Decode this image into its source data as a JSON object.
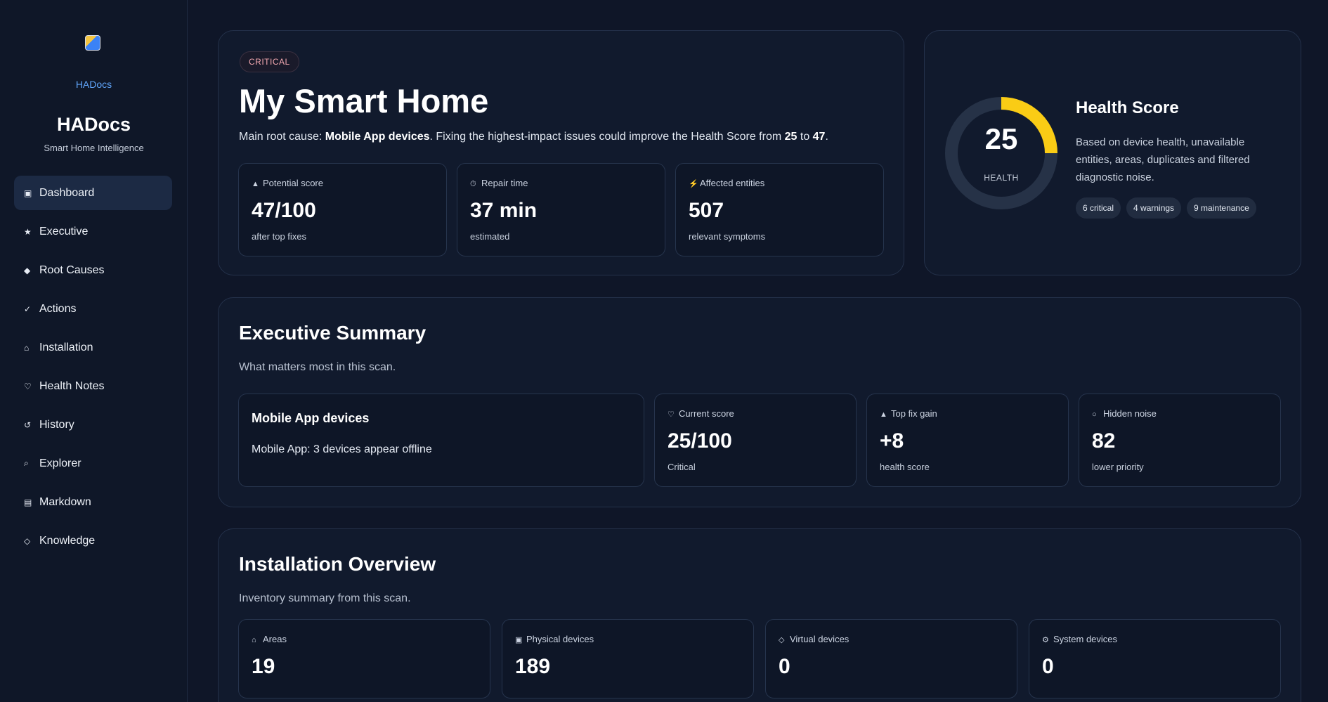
{
  "sidebar": {
    "logo_caption": "HADocs",
    "brand": "HADocs",
    "tagline": "Smart Home Intelligence",
    "items": [
      {
        "label": "Dashboard",
        "icon": "▣"
      },
      {
        "label": "Executive",
        "icon": "★"
      },
      {
        "label": "Root Causes",
        "icon": "◆"
      },
      {
        "label": "Actions",
        "icon": "✓"
      },
      {
        "label": "Installation",
        "icon": "⌂"
      },
      {
        "label": "Health Notes",
        "icon": "♡"
      },
      {
        "label": "History",
        "icon": "↺"
      },
      {
        "label": "Explorer",
        "icon": "⌕"
      },
      {
        "label": "Markdown",
        "icon": "▤"
      },
      {
        "label": "Knowledge",
        "icon": "◇"
      }
    ]
  },
  "hero": {
    "badge": "CRITICAL",
    "title": "My Smart Home",
    "desc_prefix": "Main root cause: ",
    "desc_cause": "Mobile App devices",
    "desc_middle": ". Fixing the highest-impact issues could improve the Health Score from ",
    "desc_from": "25",
    "desc_to_word": " to ",
    "desc_to": "47",
    "desc_end": ".",
    "cards": [
      {
        "label": "Potential score",
        "icon": "▲",
        "value": "47/100",
        "sub": "after top fixes"
      },
      {
        "label": "Repair time",
        "icon": "⏱",
        "value": "37 min",
        "sub": "estimated"
      },
      {
        "label": "Affected entities",
        "icon": "⚡",
        "value": "507",
        "sub": "relevant symptoms"
      }
    ]
  },
  "health": {
    "score": "25",
    "score_fraction": 0.25,
    "gauge_color": "#facc15",
    "gauge_label": "HEALTH",
    "title": "Health Score",
    "desc": "Based on device health, unavailable entities, areas, duplicates and filtered diagnostic noise.",
    "tags": [
      "6 critical",
      "4 warnings",
      "9 maintenance"
    ]
  },
  "executive": {
    "title": "Executive Summary",
    "subtitle": "What matters most in this scan.",
    "root_cause": {
      "title": "Mobile App devices",
      "text": "Mobile App: 3 devices appear offline"
    },
    "cards": [
      {
        "label": "Current score",
        "icon": "♡",
        "value": "25/100",
        "sub": "Critical"
      },
      {
        "label": "Top fix gain",
        "icon": "▲",
        "value": "+8",
        "sub": "health score"
      },
      {
        "label": "Hidden noise",
        "icon": "○",
        "value": "82",
        "sub": "lower priority"
      }
    ]
  },
  "installation": {
    "title": "Installation Overview",
    "subtitle": "Inventory summary from this scan.",
    "cards": [
      {
        "label": "Areas",
        "icon": "⌂",
        "value": "19"
      },
      {
        "label": "Physical devices",
        "icon": "▣",
        "value": "189"
      },
      {
        "label": "Virtual devices",
        "icon": "◇",
        "value": "0"
      },
      {
        "label": "System devices",
        "icon": "⚙",
        "value": "0"
      }
    ]
  }
}
